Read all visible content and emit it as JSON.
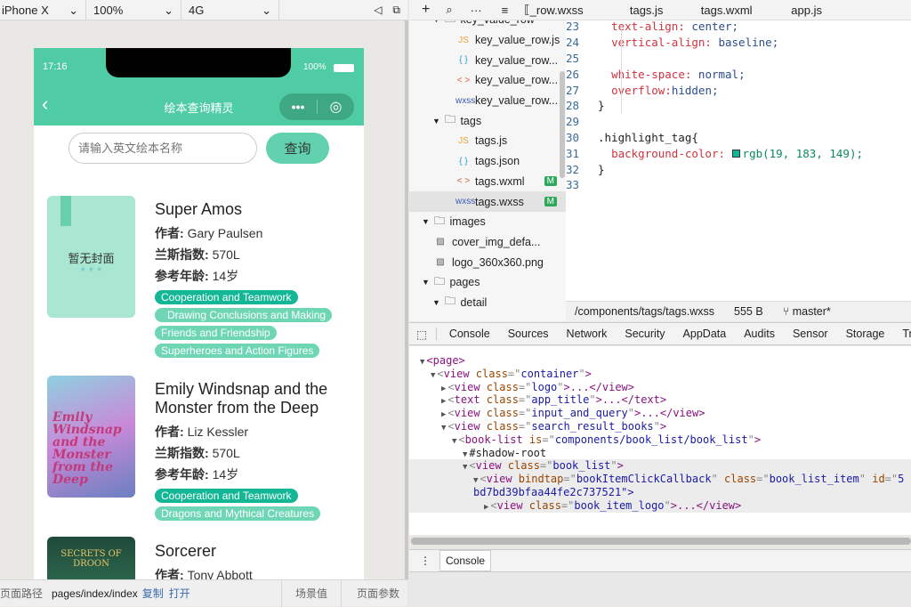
{
  "simulator_toolbar": {
    "device": "iPhone X",
    "zoom": "100%",
    "network": "4G"
  },
  "phone": {
    "status": {
      "time": "17:16",
      "battery": "100%"
    },
    "nav_title": "绘本查询精灵",
    "search": {
      "placeholder": "请输入英文绘本名称",
      "button": "查询"
    },
    "books": [
      {
        "title": "Super Amos",
        "cover_text": "暂无封面",
        "cover_stars": "★ ★ ★",
        "author_label": "作者:",
        "author": "Gary Paulsen",
        "lexile_label": "兰斯指数:",
        "lexile": "570L",
        "age_label": "参考年龄:",
        "age": "14岁",
        "tags": [
          "Cooperation and Teamwork",
          "Drawing Conclusions and Making",
          "Friends and Friendship",
          "Superheroes and Action Figures"
        ]
      },
      {
        "title": "Emily Windsnap and the Monster from the Deep",
        "cover_text": "Emily Windsnap and the Monster from the Deep",
        "author_label": "作者:",
        "author": "Liz Kessler",
        "lexile_label": "兰斯指数:",
        "lexile": "570L",
        "age_label": "参考年龄:",
        "age": "14岁",
        "tags": [
          "Cooperation and Teamwork",
          "Dragons and Mythical Creatures"
        ]
      },
      {
        "title": "Sorcerer",
        "cover_text": "SECRETS OF DROON",
        "author_label": "作者:",
        "author": "Tony Abbott"
      }
    ]
  },
  "bottom_bar": {
    "path_label": "页面路径",
    "path": "pages/index/index",
    "copy": "复制",
    "open": "打开",
    "scene": "场景值",
    "params": "页面参数"
  },
  "editor_tabs": [
    "_row.wxss",
    "tags.js",
    "tags.wxml",
    "app.js"
  ],
  "file_tree": [
    {
      "name": "key_value_row",
      "type": "folder",
      "depth": 1
    },
    {
      "name": "key_value_row.js",
      "type": "js",
      "depth": 2
    },
    {
      "name": "key_value_row...",
      "type": "json",
      "depth": 2
    },
    {
      "name": "key_value_row...",
      "type": "wxml",
      "depth": 2
    },
    {
      "name": "key_value_row...",
      "type": "wxss",
      "depth": 2
    },
    {
      "name": "tags",
      "type": "folder",
      "depth": 1
    },
    {
      "name": "tags.js",
      "type": "js",
      "depth": 2
    },
    {
      "name": "tags.json",
      "type": "json",
      "depth": 2
    },
    {
      "name": "tags.wxml",
      "type": "wxml",
      "depth": 2,
      "badge": "M"
    },
    {
      "name": "tags.wxss",
      "type": "wxss",
      "depth": 2,
      "badge": "M",
      "selected": true
    },
    {
      "name": "images",
      "type": "folder",
      "depth": 0
    },
    {
      "name": "cover_img_defa...",
      "type": "image",
      "depth": 1
    },
    {
      "name": "logo_360x360.png",
      "type": "image",
      "depth": 1
    },
    {
      "name": "pages",
      "type": "folder",
      "depth": 0
    },
    {
      "name": "detail",
      "type": "folder",
      "depth": 1
    }
  ],
  "code": [
    {
      "n": "23",
      "prop": "text-align",
      "val": "center;"
    },
    {
      "n": "24",
      "prop": "vertical-align",
      "val": "baseline;"
    },
    {
      "n": "25"
    },
    {
      "n": "26",
      "prop": "white-space",
      "val": "normal;"
    },
    {
      "n": "27",
      "prop": "overflow",
      "val": "hidden;"
    },
    {
      "n": "28",
      "text": "}"
    },
    {
      "n": "29"
    },
    {
      "n": "30",
      "text": ".highlight_tag{"
    },
    {
      "n": "31",
      "prop": "background-color",
      "val": "rgb(19, 183, 149);"
    },
    {
      "n": "32",
      "text": "}"
    },
    {
      "n": "33"
    }
  ],
  "highlight_color": "#13b795",
  "editor_status": {
    "path": "/components/tags/tags.wxss",
    "size": "555 B",
    "branch": "master*"
  },
  "devtools_tabs": [
    "Console",
    "Sources",
    "Network",
    "Security",
    "AppData",
    "Audits",
    "Sensor",
    "Storage",
    "Trace"
  ],
  "dom_tree": [
    {
      "d": 0,
      "a": "▼",
      "t": "<page>"
    },
    {
      "d": 1,
      "a": "▼",
      "tag": "view",
      "attr": "class",
      "val": "container",
      "end": ">"
    },
    {
      "d": 2,
      "a": "▶",
      "tag": "view",
      "attr": "class",
      "val": "logo",
      "end": ">...</view>"
    },
    {
      "d": 2,
      "a": "▶",
      "tag": "text",
      "attr": "class",
      "val": "app_title",
      "end": ">...</text>"
    },
    {
      "d": 2,
      "a": "▶",
      "tag": "view",
      "attr": "class",
      "val": "input_and_query",
      "end": ">...</view>"
    },
    {
      "d": 2,
      "a": "▼",
      "tag": "view",
      "attr": "class",
      "val": "search_result_books",
      "end": ">"
    },
    {
      "d": 3,
      "a": "▼",
      "tag": "book-list",
      "attr": "is",
      "val": "components/book_list/book_list",
      "end": ">"
    },
    {
      "d": 4,
      "a": "▼",
      "t": "#shadow-root"
    },
    {
      "d": 4,
      "a": "▼",
      "tag": "view",
      "attr": "class",
      "val": "book_list",
      "end": ">",
      "hl": true
    },
    {
      "d": 5,
      "a": "▼",
      "tag": "view",
      "attr": "bindtap",
      "val": "bookItemClickCallback",
      "attr2": "class",
      "val2": "book_list_item",
      "attr3": "id",
      "val3": "5",
      "hl": true
    },
    {
      "d": 5,
      "a": "",
      "t": "bd7bd39bfaa44fe2c737521\">",
      "cont": true,
      "hl": true
    },
    {
      "d": 6,
      "a": "▶",
      "tag": "view",
      "attr": "class",
      "val": "book_item_logo",
      "end": ">...</view>",
      "hl": true
    }
  ],
  "drawer_tab": "Console"
}
